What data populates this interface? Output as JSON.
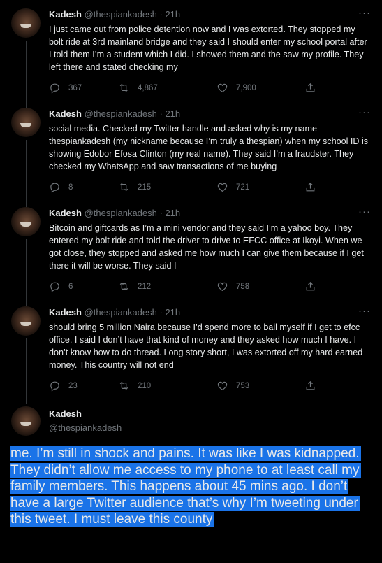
{
  "tweets": [
    {
      "name": "Kadesh",
      "handle": "@thespiankadesh",
      "time": "· 21h",
      "text": "I just came out from police detention now and I was extorted. They stopped my bolt ride at 3rd mainland bridge and they said I should enter my school portal after I told them I’m a student which I did. I showed them and the saw my profile. They left there and stated checking my",
      "replies": "367",
      "retweets": "4,867",
      "likes": "7,900"
    },
    {
      "name": "Kadesh",
      "handle": "@thespiankadesh",
      "time": "· 21h",
      "text": "social media. Checked my Twitter handle and asked why is my name thespiankadesh (my nickname because I’m truly a thespian) when my school ID is showing Edobor Efosa Clinton (my real name). They said I’m a fraudster. They checked my WhatsApp and saw transactions of me buying",
      "replies": "8",
      "retweets": "215",
      "likes": "721"
    },
    {
      "name": "Kadesh",
      "handle": "@thespiankadesh",
      "time": "· 21h",
      "text": "Bitcoin and giftcards as I’m a mini vendor and they said I’m a yahoo boy. They entered my bolt ride and told the driver to drive to EFCC office at Ikoyi. When we got close, they stopped and asked me how much I can give them because if I get there it will be worse. They said I",
      "replies": "6",
      "retweets": "212",
      "likes": "758"
    },
    {
      "name": "Kadesh",
      "handle": "@thespiankadesh",
      "time": "· 21h",
      "text": "should bring 5 million Naira because I’d spend more to bail myself if I get to efcc office. I said I don’t have that kind of money and they asked how much I have. I don’t know how to do thread. Long story short, I was extorted off my hard earned money. This country will not end",
      "replies": "23",
      "retweets": "210",
      "likes": "753"
    }
  ],
  "main_tweet": {
    "name": "Kadesh",
    "handle": "@thespiankadesh",
    "text": "me. I’m still in shock and pains. It was like I was kidnapped. They didn’t allow me access to my phone to at least call my family members. This happens about 45 mins ago. I don’t have a large Twitter audience that’s why I’m tweeting under this tweet. I must leave this county"
  },
  "more_glyph": "···",
  "colors": {
    "background": "#000000",
    "text": "#e7e9ea",
    "muted": "#71767b",
    "selection": "#1a73e8"
  },
  "icons": [
    "reply-icon",
    "retweet-icon",
    "like-icon",
    "share-icon",
    "more-icon"
  ]
}
